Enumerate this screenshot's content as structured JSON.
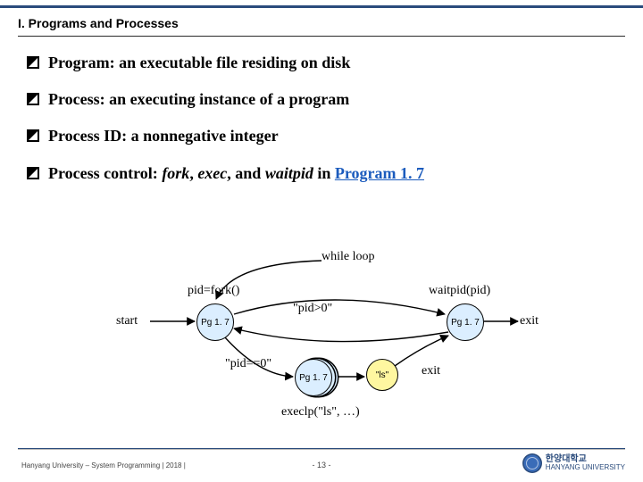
{
  "section": {
    "number": "I.",
    "title": "Programs and Processes"
  },
  "bullets": [
    {
      "plain": "Program: an executable file residing on disk"
    },
    {
      "plain": "Process: an executing instance of a program"
    },
    {
      "plain": "Process ID: a nonnegative integer"
    },
    {
      "prefix": "Process control: ",
      "em1": "fork",
      "mid1": ", ",
      "em2": "exec",
      "mid2": ", and ",
      "em3": "waitpid",
      "suffix": " in ",
      "link": "Program 1. 7"
    }
  ],
  "diagram": {
    "labels": {
      "while_loop": "while loop",
      "pid_fork": "pid=fork()",
      "start": "start",
      "pid_gt0": "\"pid>0\"",
      "pid_eq0": "\"pid==0\"",
      "waitpid": "waitpid(pid)",
      "exit_right": "exit",
      "exit_mid": "exit",
      "ls": "\"ls\"",
      "execlp": "execlp(\"ls\", …)"
    },
    "nodes": {
      "parent_left": "Pg 1. 7",
      "parent_right": "Pg 1. 7",
      "child": "Pg 1. 7"
    }
  },
  "footer": {
    "left": "Hanyang University – System Programming | 2018 |",
    "page": "- 13 -",
    "uni_kr": "한양대학교",
    "uni_en": "HANYANG UNIVERSITY"
  }
}
